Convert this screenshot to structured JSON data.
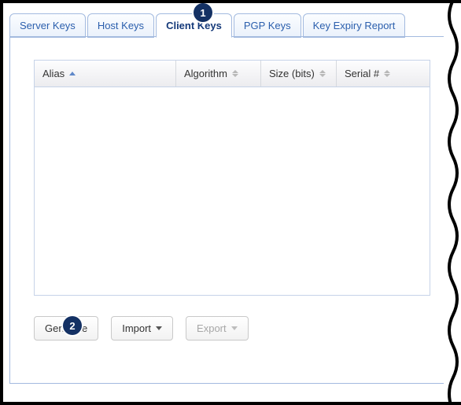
{
  "tabs": [
    {
      "label": "Server Keys",
      "selected": false
    },
    {
      "label": "Host Keys",
      "selected": false
    },
    {
      "label": "Client Keys",
      "selected": true
    },
    {
      "label": "PGP Keys",
      "selected": false
    },
    {
      "label": "Key Expiry Report",
      "selected": false
    }
  ],
  "columns": {
    "alias": "Alias",
    "algorithm": "Algorithm",
    "size": "Size (bits)",
    "serial": "Serial #"
  },
  "sort": {
    "column": "alias",
    "dir": "asc"
  },
  "rows": [],
  "buttons": {
    "generate": "Generate",
    "import": "Import",
    "export": "Export"
  },
  "callouts": {
    "tab": "1",
    "generate": "2"
  },
  "colors": {
    "callout_bg": "#143164",
    "tab_text": "#2b5fad",
    "border": "#a3badf",
    "sort_active": "#5f88c9"
  }
}
